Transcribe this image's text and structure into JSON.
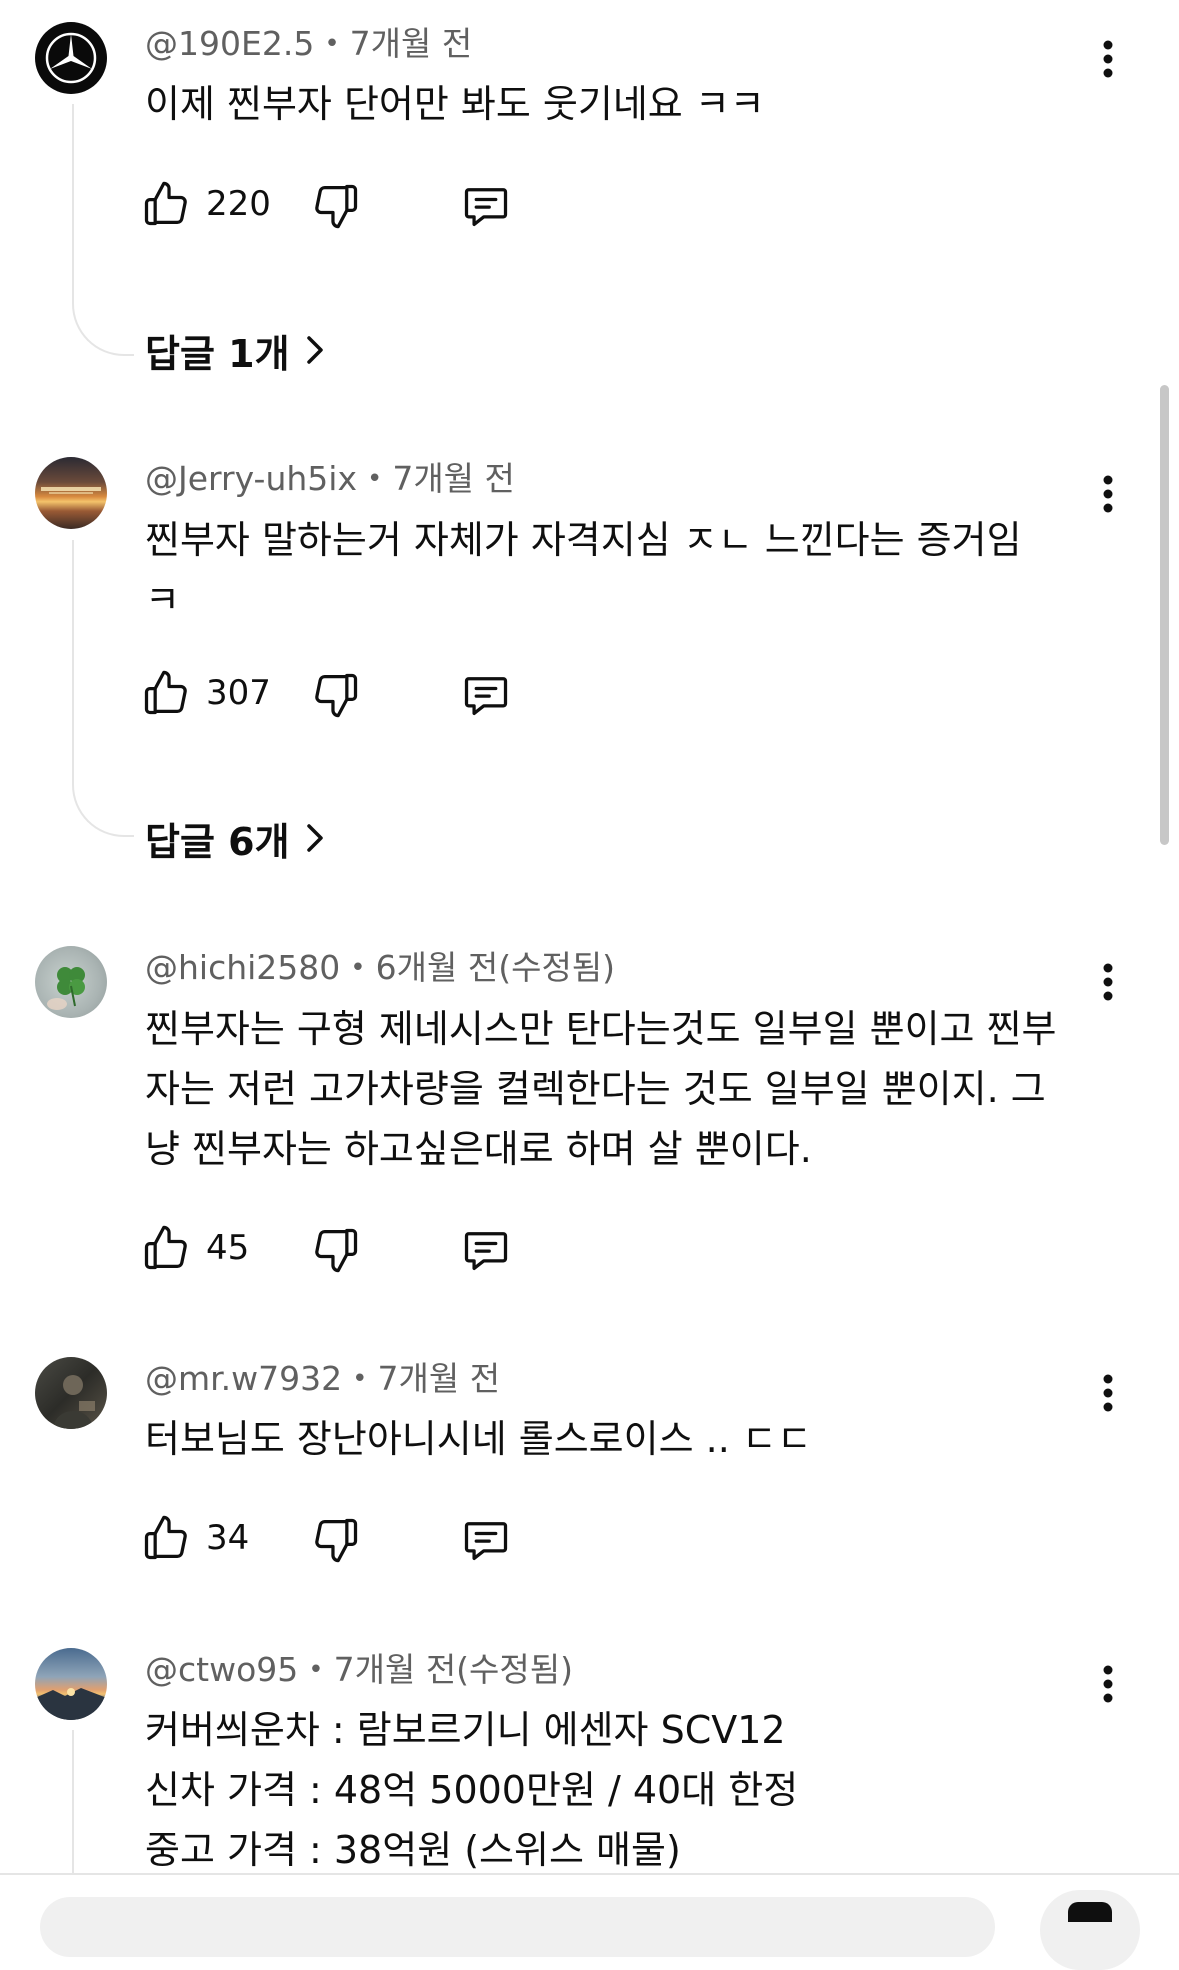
{
  "comments": [
    {
      "handle": "@190E2.5",
      "time": "7개월 전",
      "lines": [
        "이제 찐부자 단어만 봐도 웃기네요 ㅋㅋ"
      ],
      "likes": "220",
      "replies_label": "답글 1개"
    },
    {
      "handle": "@Jerry-uh5ix",
      "time": "7개월 전",
      "lines": [
        "찐부자 말하는거 자체가 자격지심 ㅈㄴ 느낀다는 증거임",
        "ㅋ"
      ],
      "likes": "307",
      "replies_label": "답글 6개"
    },
    {
      "handle": "@hichi2580",
      "time": "6개월 전(수정됨)",
      "lines": [
        "찐부자는 구형 제네시스만 탄다는것도 일부일 뿐이고 찐부",
        "자는 저런 고가차량을 컬렉한다는 것도 일부일 뿐이지. 그",
        "냥 찐부자는 하고싶은대로 하며 살 뿐이다."
      ],
      "likes": "45"
    },
    {
      "handle": "@mr.w7932",
      "time": "7개월 전",
      "lines": [
        "터보님도 장난아니시네 롤스로이스 .. ㄷㄷ"
      ],
      "likes": "34"
    },
    {
      "handle": "@ctwo95",
      "time": "7개월 전(수정됨)",
      "lines": [
        "커버씌운차 : 람보르기니 에센자 SCV12",
        "신차 가격 : 48억 5000만원 / 40대 한정",
        "중고 가격 : 38억원 (스위스 매물)"
      ]
    }
  ],
  "icons": {
    "like": "thumbs-up-icon",
    "dislike": "thumbs-down-icon",
    "reply": "reply-comment-icon",
    "more": "more-vertical-icon",
    "chevron": "chevron-right-icon"
  },
  "colors": {
    "text": "#0f0f0f",
    "meta": "#606060",
    "thread_line": "#e5e5e5",
    "background": "#ffffff"
  }
}
